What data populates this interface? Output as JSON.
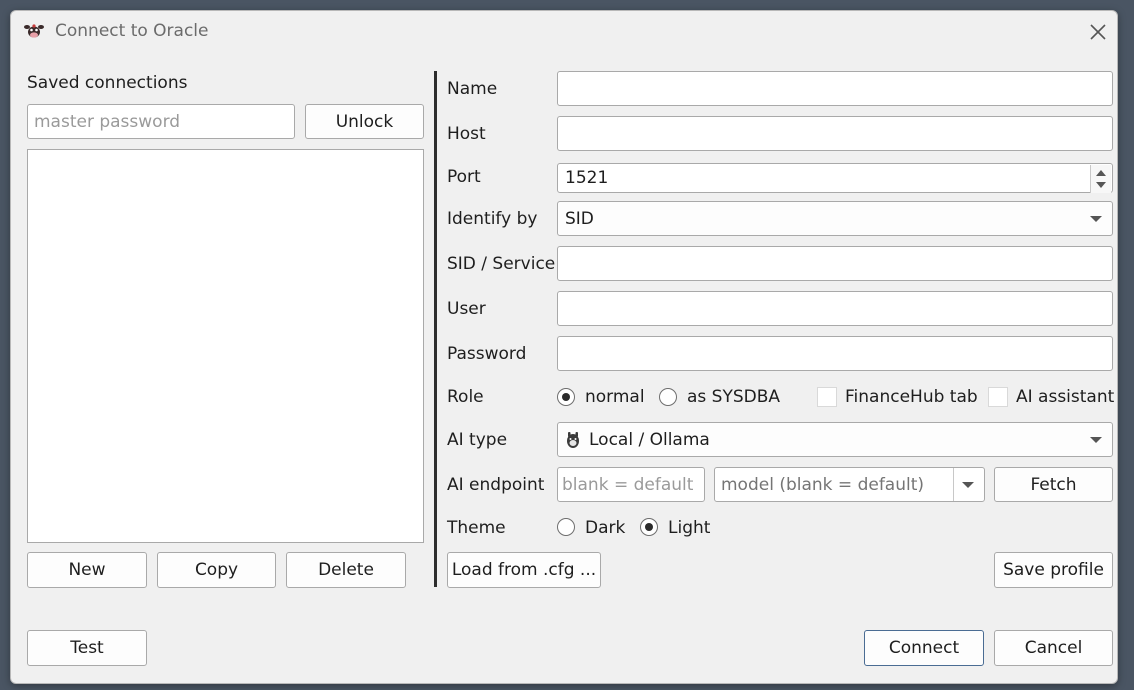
{
  "window": {
    "title": "Connect to Oracle",
    "app_icon": "cow-icon",
    "close_icon": "close-icon"
  },
  "saved": {
    "heading": "Saved connections",
    "master_password_placeholder": "master password",
    "master_password_value": "",
    "unlock_label": "Unlock",
    "items": [],
    "new_label": "New",
    "copy_label": "Copy",
    "delete_label": "Delete"
  },
  "form": {
    "name": {
      "label": "Name",
      "value": ""
    },
    "host": {
      "label": "Host",
      "value": ""
    },
    "port": {
      "label": "Port",
      "value": "1521"
    },
    "identify_by": {
      "label": "Identify by",
      "value": "SID"
    },
    "sid_service": {
      "label": "SID / Service",
      "value": ""
    },
    "user": {
      "label": "User",
      "value": ""
    },
    "password": {
      "label": "Password",
      "value": ""
    },
    "role": {
      "label": "Role",
      "options": [
        "normal",
        "as SYSDBA"
      ],
      "selected": "normal",
      "financehub_label": "FinanceHub tab",
      "financehub_checked": false,
      "ai_assistant_label": "AI assistant",
      "ai_assistant_checked": false
    },
    "ai_type": {
      "label": "AI type",
      "value": "Local / Ollama",
      "icon": "llama-icon"
    },
    "ai_endpoint": {
      "label": "AI endpoint",
      "endpoint_placeholder": "blank = default ...",
      "model_placeholder": "model (blank = default)",
      "fetch_label": "Fetch"
    },
    "theme": {
      "label": "Theme",
      "options": [
        "Dark",
        "Light"
      ],
      "selected": "Light"
    },
    "load_label": "Load from .cfg ...",
    "save_label": "Save profile"
  },
  "footer": {
    "test_label": "Test",
    "connect_label": "Connect",
    "cancel_label": "Cancel"
  }
}
